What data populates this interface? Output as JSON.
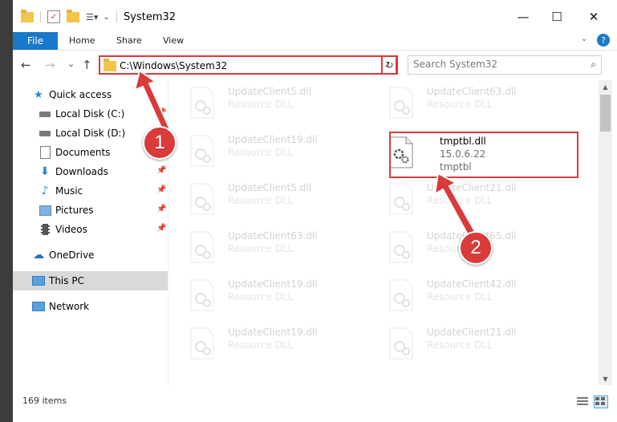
{
  "window": {
    "title": "System32",
    "controls": {
      "minimize": "—",
      "maximize": "☐",
      "close": "✕"
    }
  },
  "ribbon": {
    "tabs": [
      {
        "label": "File",
        "active": true
      },
      {
        "label": "Home"
      },
      {
        "label": "Share"
      },
      {
        "label": "View"
      }
    ],
    "help_label": "?"
  },
  "nav": {
    "back": "←",
    "forward": "→",
    "recent": "⌄",
    "up": "↑",
    "address": "C:\\Windows\\System32",
    "address_chevron": "⌄",
    "refresh": "↻",
    "search_placeholder": "Search System32",
    "search_icon": "⌕"
  },
  "sidebar": {
    "items": [
      {
        "label": "Quick access",
        "icon": "star-icon",
        "pinned": false
      },
      {
        "label": "Local Disk (C:)",
        "icon": "drive-icon",
        "pinned": true
      },
      {
        "label": "Local Disk (D:)",
        "icon": "drive-icon",
        "pinned": false
      },
      {
        "label": "Documents",
        "icon": "documents-icon",
        "pinned": true
      },
      {
        "label": "Downloads",
        "icon": "download-icon",
        "pinned": true
      },
      {
        "label": "Music",
        "icon": "music-icon",
        "pinned": true
      },
      {
        "label": "Pictures",
        "icon": "pictures-icon",
        "pinned": true
      },
      {
        "label": "Videos",
        "icon": "videos-icon",
        "pinned": true
      },
      {
        "label": "OneDrive",
        "icon": "cloud-icon",
        "pinned": false
      },
      {
        "label": "This PC",
        "icon": "computer-icon",
        "pinned": false,
        "selected": true
      },
      {
        "label": "Network",
        "icon": "network-icon",
        "pinned": false
      }
    ],
    "pin_glyph": "📌"
  },
  "files": [
    {
      "name": "UpdateClient5.dll",
      "type": "Resource DLL",
      "faded": true
    },
    {
      "name": "UpdateClient63.dll",
      "type": "Resource DLL",
      "faded": true
    },
    {
      "name": "UpdateClient19.dll",
      "type": "Resource DLL",
      "faded": true
    },
    {
      "name": "tmptbl.dll",
      "version": "15.0.6.22",
      "type": "tmptbl",
      "faded": false,
      "highlighted": true
    },
    {
      "name": "UpdateClient5.dll",
      "type": "Resource DLL",
      "faded": true
    },
    {
      "name": "UpdateClient21.dll",
      "type": "Resource DLL",
      "faded": true
    },
    {
      "name": "UpdateClient63.dll",
      "type": "Resource DLL",
      "faded": true
    },
    {
      "name": "UpdateClient65.dll",
      "type": "Resource DLL",
      "faded": true
    },
    {
      "name": "UpdateClient19.dll",
      "type": "Resource DLL",
      "faded": true
    },
    {
      "name": "UpdateClient42.dll",
      "type": "Resource DLL",
      "faded": true
    },
    {
      "name": "UpdateClient19.dll",
      "type": "Resource DLL",
      "faded": true
    },
    {
      "name": "UpdateClient21.dll",
      "type": "Resource DLL",
      "faded": true
    }
  ],
  "status": {
    "item_count": "169 items"
  },
  "callouts": [
    {
      "number": "1"
    },
    {
      "number": "2"
    }
  ],
  "colors": {
    "accent": "#1979ca",
    "callout": "#d93a3a",
    "folder": "#f3c64a",
    "selected": "#d9d9d9"
  }
}
